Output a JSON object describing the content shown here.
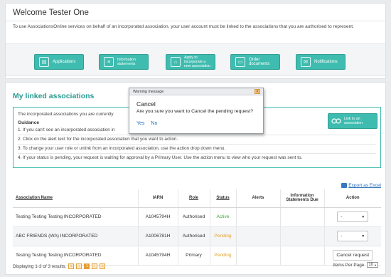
{
  "welcome": {
    "title": "Welcome Tester One",
    "intro": "To use AssociationsOnline services on behalf of an incorporated association, your user account must be linked to the associations that you are authorised to represent."
  },
  "tiles": [
    {
      "label": "Applications",
      "icon": "document-icon"
    },
    {
      "label": "Information statements",
      "icon": "report-icon"
    },
    {
      "label": "Apply to incorporate a new association",
      "icon": "building-icon"
    },
    {
      "label": "Order documents",
      "icon": "order-icon"
    },
    {
      "label": "Notifications",
      "icon": "mail-icon"
    }
  ],
  "linked": {
    "title": "My linked associations",
    "intro": "The incorporated associations you are currently",
    "guidance_label": "Guidance",
    "guidance": [
      "1. If you can't see an incorporated association in",
      "2. Click on the alert text for the incorporated association that you want to action.",
      "3. To change your user role or unlink from an incorporated association, use the action drop down menu.",
      "4. If your status is pending, your request is waiting for approval by a Primary User. Use the action menu to view who your request was sent to."
    ],
    "link_button": "Link to an association"
  },
  "export_label": "Export as Excel",
  "table": {
    "headers": {
      "name": "Association Name",
      "iarn": "IARN",
      "role": "Role",
      "status": "Status",
      "alerts": "Alerts",
      "info": "Information Statements Due",
      "action": "Action"
    },
    "rows": [
      {
        "name": "Testing Testing Testing INCORPORATED",
        "iarn": "A1045794H",
        "role": "Authorised",
        "status": "Active",
        "action": "-"
      },
      {
        "name": "ABC FRIENDS (WA) INCORPORATED",
        "iarn": "A1006781H",
        "role": "Authorised",
        "status": "Pending",
        "action": "-"
      },
      {
        "name": "Testing Testing Testing INCORPORATED",
        "iarn": "A1045794H",
        "role": "Primary",
        "status": "Pending",
        "action": "Cancel request"
      }
    ]
  },
  "footer": {
    "displaying": "Displaying 1-3 of 3 results.",
    "current_page": "1",
    "items_per_page_label": "Items Per Page",
    "items_per_page": "10"
  },
  "modal": {
    "header": "Warning message",
    "title": "Cancel",
    "message": "Are you sure you want to Cancel the pending request?",
    "yes": "Yes",
    "no": "No"
  },
  "colors": {
    "accent": "#3fbcb0",
    "title": "#2a9c91",
    "active": "#3aa63a",
    "pending": "#e6a22a",
    "link": "#2a6fb8"
  }
}
